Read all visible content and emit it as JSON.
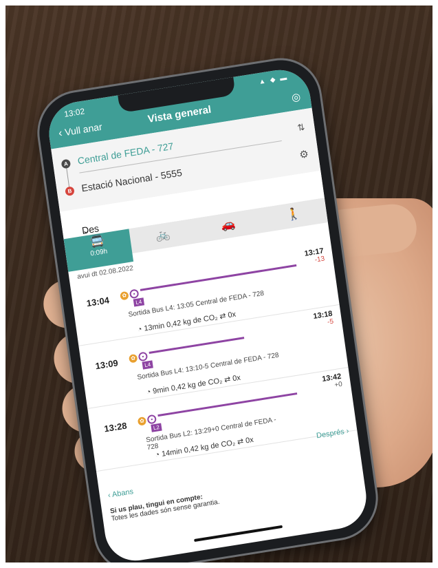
{
  "status_bar": {
    "time": "13:02",
    "icons": "▲ ◆ ▬"
  },
  "header": {
    "back_label": "Vull anar",
    "title": "Vista general"
  },
  "route": {
    "origin": "Central de FEDA - 727",
    "destination": "Estació Nacional - 5555",
    "pin_a": "A",
    "pin_b": "B"
  },
  "departure": {
    "label": "Des de ara",
    "dropdown_icon": "chevron-down-icon"
  },
  "modes": [
    {
      "icon": "bus-icon",
      "symbol": "🚍",
      "duration": "0:09h",
      "active": true
    },
    {
      "icon": "bicycle-icon",
      "symbol": "🚲"
    },
    {
      "icon": "car-icon",
      "symbol": "🚗"
    },
    {
      "icon": "walk-icon",
      "symbol": "🚶"
    }
  ],
  "date_label": "avui dt 02.08.2022",
  "trips": [
    {
      "departure": "13:04",
      "line": "L4",
      "arrival": "13:17",
      "delay": "-13",
      "description": "Sortida Bus L4: 13:05 Central de FEDA - 728",
      "meta": "13min  0,42 kg de CO₂  ⇄ 0x"
    },
    {
      "departure": "13:09",
      "line": "L4",
      "arrival": "13:18",
      "delay": "-5",
      "description": "Sortida Bus L4: 13:10-5 Central de FEDA - 728",
      "meta": "9min  0,42 kg de CO₂  ⇄ 0x"
    },
    {
      "departure": "13:28",
      "line": "L2",
      "arrival": "13:42",
      "delay": "+0",
      "description": "Sortida Bus L2: 13:29+0 Central de FEDA - 728",
      "meta": "14min  0,42 kg de CO₂  ⇄ 0x"
    }
  ],
  "nav": {
    "prev": "Abans",
    "next": "Després"
  },
  "notice": {
    "title": "Si us plau, tingui en compte:",
    "body": "Totes les dades són sense garantia."
  },
  "colors": {
    "accent": "#3f9e96",
    "line": "#8e44a3",
    "walk": "#e9a02f",
    "delay": "#d6453d"
  }
}
